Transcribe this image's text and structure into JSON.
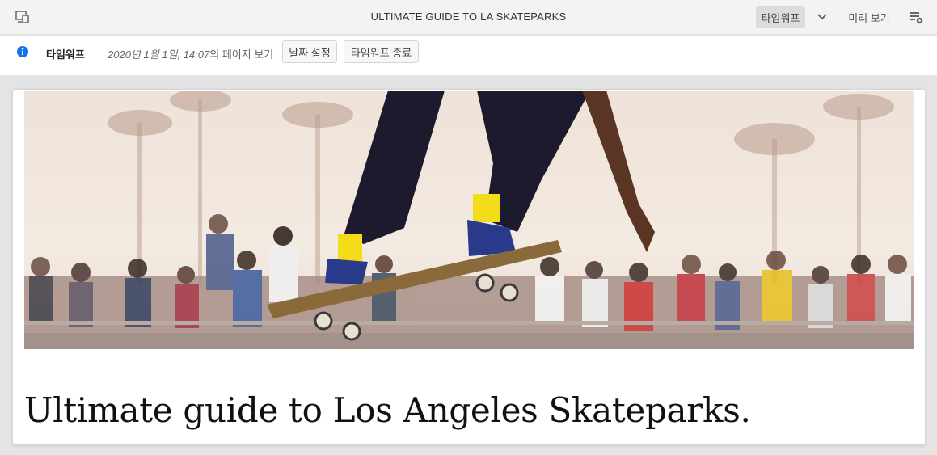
{
  "topbar": {
    "title": "ULTIMATE GUIDE TO LA SKATEPARKS",
    "mode_label": "타임워프",
    "preview_label": "미리 보기",
    "icons": {
      "device": "emulator-icon",
      "chevron": "chevron-down-icon",
      "settings": "page-properties-icon"
    }
  },
  "timewarp": {
    "label": "타임워프",
    "date_value": "2020년 1월 1일, 14:07",
    "date_suffix": "의 페이지 보기",
    "set_date_label": "날짜 설정",
    "exit_label": "타임워프 종료",
    "info_color": "#1473e6"
  },
  "content": {
    "hero_image": "skateboarder-hero-image",
    "heading": "Ultimate guide to Los Angeles Skateparks."
  }
}
